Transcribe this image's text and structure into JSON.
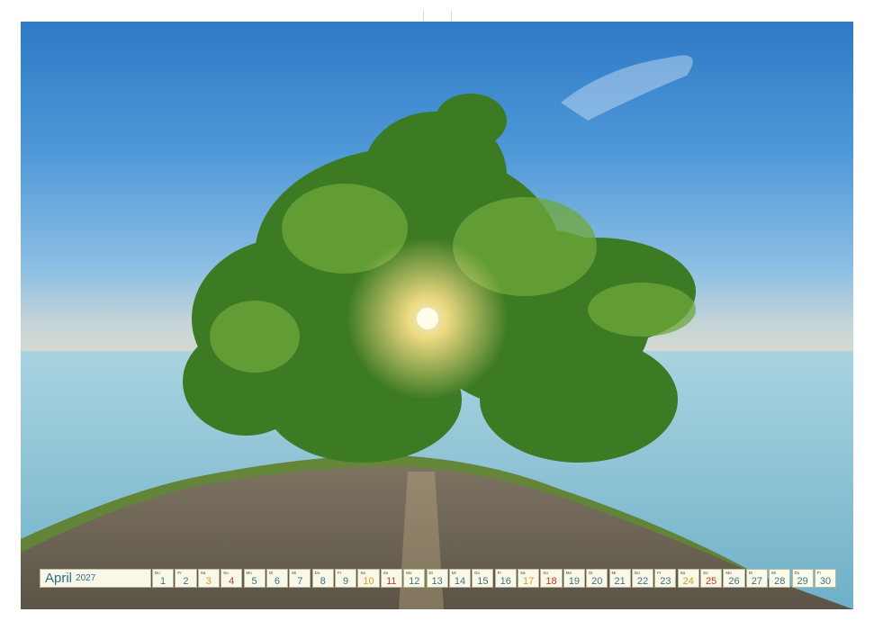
{
  "calendar": {
    "month": "April",
    "year": "2027",
    "days": [
      {
        "n": "1",
        "wd": "Do",
        "kind": "weekday"
      },
      {
        "n": "2",
        "wd": "Fr",
        "kind": "weekday"
      },
      {
        "n": "3",
        "wd": "Sa",
        "kind": "sat"
      },
      {
        "n": "4",
        "wd": "So",
        "kind": "sun"
      },
      {
        "n": "5",
        "wd": "Mo",
        "kind": "weekday"
      },
      {
        "n": "6",
        "wd": "Di",
        "kind": "weekday"
      },
      {
        "n": "7",
        "wd": "Mi",
        "kind": "weekday"
      },
      {
        "n": "8",
        "wd": "Do",
        "kind": "weekday"
      },
      {
        "n": "9",
        "wd": "Fr",
        "kind": "weekday"
      },
      {
        "n": "10",
        "wd": "Sa",
        "kind": "sat"
      },
      {
        "n": "11",
        "wd": "So",
        "kind": "sun"
      },
      {
        "n": "12",
        "wd": "Mo",
        "kind": "weekday"
      },
      {
        "n": "13",
        "wd": "Di",
        "kind": "weekday"
      },
      {
        "n": "14",
        "wd": "Mi",
        "kind": "weekday"
      },
      {
        "n": "15",
        "wd": "Do",
        "kind": "weekday"
      },
      {
        "n": "16",
        "wd": "Fr",
        "kind": "weekday"
      },
      {
        "n": "17",
        "wd": "Sa",
        "kind": "sat"
      },
      {
        "n": "18",
        "wd": "So",
        "kind": "sun"
      },
      {
        "n": "19",
        "wd": "Mo",
        "kind": "weekday"
      },
      {
        "n": "20",
        "wd": "Di",
        "kind": "weekday"
      },
      {
        "n": "21",
        "wd": "Mi",
        "kind": "weekday"
      },
      {
        "n": "22",
        "wd": "Do",
        "kind": "weekday"
      },
      {
        "n": "23",
        "wd": "Fr",
        "kind": "weekday"
      },
      {
        "n": "24",
        "wd": "Sa",
        "kind": "sat"
      },
      {
        "n": "25",
        "wd": "So",
        "kind": "sun"
      },
      {
        "n": "26",
        "wd": "Mo",
        "kind": "weekday"
      },
      {
        "n": "27",
        "wd": "Di",
        "kind": "weekday"
      },
      {
        "n": "28",
        "wd": "Mi",
        "kind": "weekday"
      },
      {
        "n": "29",
        "wd": "Do",
        "kind": "weekday"
      },
      {
        "n": "30",
        "wd": "Fr",
        "kind": "weekday"
      }
    ]
  },
  "colors": {
    "weekday": "#3f6f86",
    "saturday": "#d79a2b",
    "sunday": "#c0392b"
  }
}
